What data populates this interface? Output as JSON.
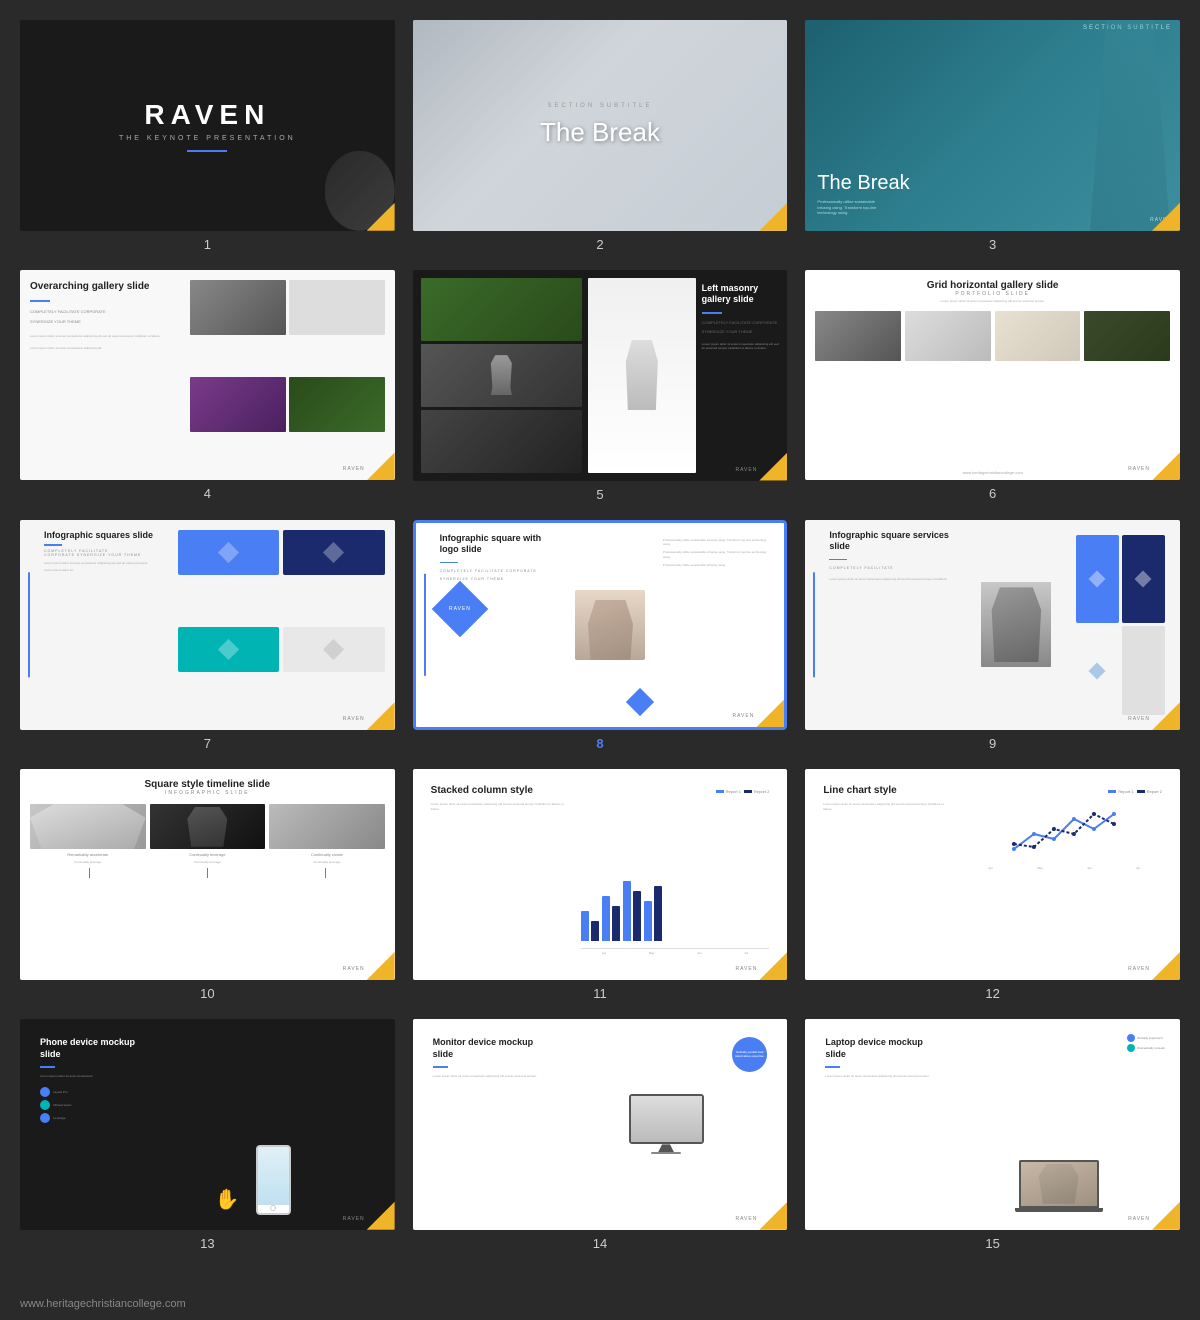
{
  "watermark": "www.heritagechristiancollege.com",
  "slides": [
    {
      "number": "1",
      "title": "RAVEN",
      "subtitle": "THE KEYNOTE PRESENTATION",
      "type": "title-dark"
    },
    {
      "number": "2",
      "section_sub": "SECTION SUBTITLE",
      "title": "The Break",
      "type": "break-light"
    },
    {
      "number": "3",
      "section_sub": "SECTION SUBTITLE",
      "title": "The Break",
      "type": "break-teal"
    },
    {
      "number": "4",
      "heading": "Overarching gallery slide",
      "tag1": "COMPLETELY FACILITATE CORPORATE",
      "tag2": "SYNERGIZE YOUR THEME",
      "type": "gallery"
    },
    {
      "number": "5",
      "heading": "Left masonry gallery slide",
      "tag1": "COMPLETELY FACILITATE CORPORATE",
      "tag2": "SYNERGIZE YOUR THEME",
      "type": "masonry"
    },
    {
      "number": "6",
      "heading": "Grid horizontal gallery slide",
      "sub": "PORTFOLIO SLIDE",
      "type": "grid-gallery"
    },
    {
      "number": "7",
      "heading": "Infographic squares slide",
      "tag1": "COMPLETELY FACILITATE",
      "tag2": "CORPORATE SYNERGIZE YOUR THEME",
      "type": "infographic-sq"
    },
    {
      "number": "8",
      "heading": "Infographic square with logo slide",
      "tag1": "COMPLETELY FACILITATE CORPORATE",
      "tag2": "SYNERGIZE YOUR THEME",
      "type": "infographic-logo",
      "active": true
    },
    {
      "number": "9",
      "heading": "Infographic square services slide",
      "tag1": "COMPLETELY FACILITATE",
      "tag2": "CORPORATE SYNERGIZE YOUR THEME",
      "type": "infographic-services"
    },
    {
      "number": "10",
      "heading": "Square style timeline slide",
      "sub": "INFOGRAPHIC SLIDE",
      "type": "timeline"
    },
    {
      "number": "11",
      "heading": "Stacked column style",
      "type": "chart-stacked"
    },
    {
      "number": "12",
      "heading": "Line chart style",
      "type": "chart-line"
    },
    {
      "number": "13",
      "heading": "Phone device mockup slide",
      "type": "mockup-phone"
    },
    {
      "number": "14",
      "heading": "Monitor device mockup slide",
      "type": "mockup-monitor"
    },
    {
      "number": "15",
      "heading": "Laptop device mockup slide",
      "type": "mockup-laptop"
    }
  ]
}
